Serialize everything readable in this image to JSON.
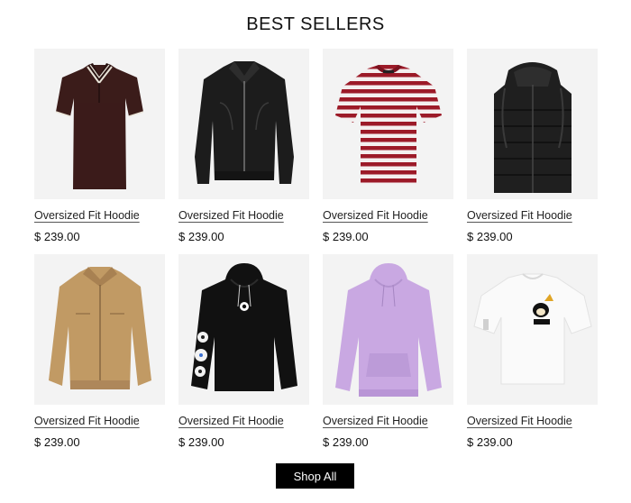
{
  "section": {
    "title": "BEST SELLERS"
  },
  "products": [
    {
      "name": "Oversized Fit Hoodie",
      "price": "$ 239.00",
      "image": "polo-shirt-maroon"
    },
    {
      "name": "Oversized Fit Hoodie",
      "price": "$ 239.00",
      "image": "leather-jacket-black"
    },
    {
      "name": "Oversized Fit Hoodie",
      "price": "$ 239.00",
      "image": "striped-tshirt-red"
    },
    {
      "name": "Oversized Fit Hoodie",
      "price": "$ 239.00",
      "image": "puffer-vest-black"
    },
    {
      "name": "Oversized Fit Hoodie",
      "price": "$ 239.00",
      "image": "harrington-jacket-tan"
    },
    {
      "name": "Oversized Fit Hoodie",
      "price": "$ 239.00",
      "image": "disney-hoodie-black"
    },
    {
      "name": "Oversized Fit Hoodie",
      "price": "$ 239.00",
      "image": "hoodie-lilac"
    },
    {
      "name": "Oversized Fit Hoodie",
      "price": "$ 239.00",
      "image": "goofy-tshirt-white"
    }
  ],
  "cta": {
    "label": "Shop All"
  },
  "colors": {
    "background": "#ffffff",
    "tile": "#f3f3f3",
    "button": "#000000",
    "buttonText": "#ffffff"
  }
}
